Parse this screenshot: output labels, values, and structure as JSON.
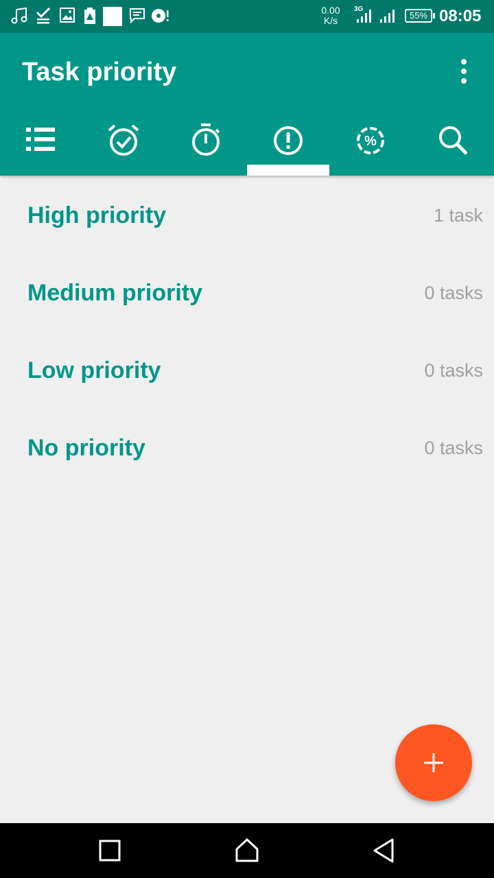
{
  "status_bar": {
    "speed_value": "0.00",
    "speed_unit": "K/s",
    "network": "3G",
    "battery": "55%",
    "time": "08:05"
  },
  "app_bar": {
    "title": "Task priority"
  },
  "tabs": [
    {
      "icon": "list-icon",
      "selected": false
    },
    {
      "icon": "alarm-check-icon",
      "selected": false
    },
    {
      "icon": "stopwatch-icon",
      "selected": false
    },
    {
      "icon": "priority-icon",
      "selected": true
    },
    {
      "icon": "progress-percent-icon",
      "selected": false
    },
    {
      "icon": "search-icon",
      "selected": false
    }
  ],
  "priorities": [
    {
      "label": "High priority",
      "count": "1 task"
    },
    {
      "label": "Medium priority",
      "count": "0 tasks"
    },
    {
      "label": "Low priority",
      "count": "0 tasks"
    },
    {
      "label": "No priority",
      "count": "0 tasks"
    }
  ],
  "colors": {
    "status_bar": "#00796b",
    "app_bar": "#009688",
    "accent": "#009688",
    "fab": "#ff5722",
    "background": "#efefef"
  }
}
